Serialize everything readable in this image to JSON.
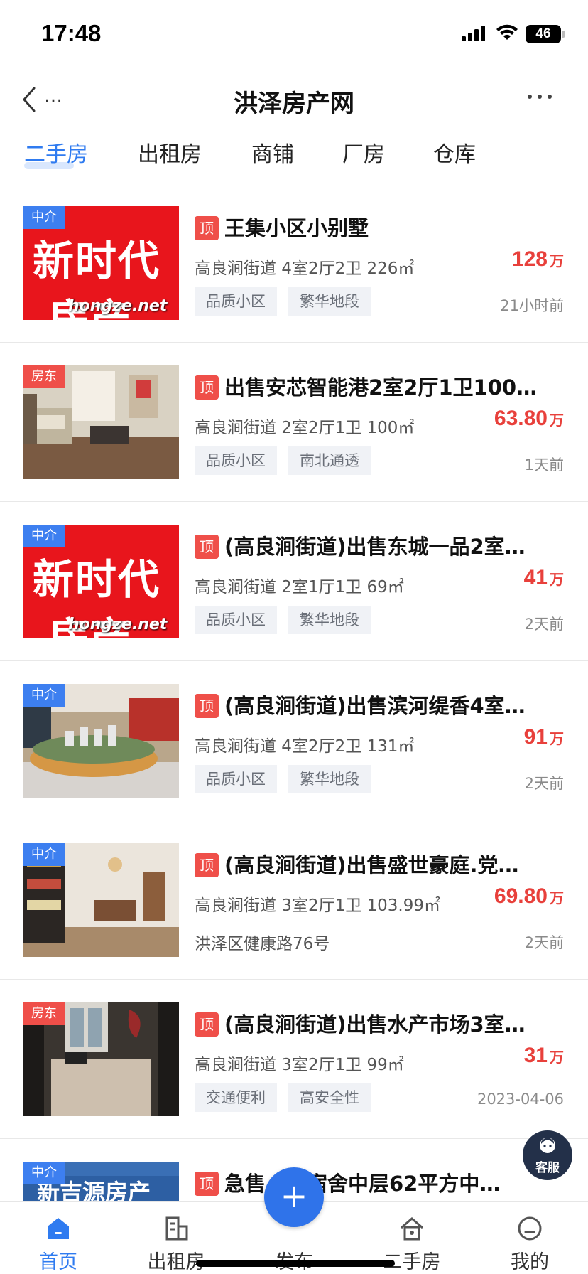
{
  "status_bar": {
    "time": "17:48",
    "battery": "46"
  },
  "navbar": {
    "back_dots": "…",
    "title": "洪泽房产网"
  },
  "tabs": [
    {
      "label": "二手房",
      "active": true
    },
    {
      "label": "出租房",
      "active": false
    },
    {
      "label": "商铺",
      "active": false
    },
    {
      "label": "厂房",
      "active": false
    },
    {
      "label": "仓库",
      "active": false
    }
  ],
  "top_badge": "顶",
  "price_unit": "万",
  "ad": {
    "line1": "新时代",
    "line2": "房产",
    "url": "hongze.net",
    "line1_alt": "新吉源房产"
  },
  "listings": [
    {
      "tag": "中介",
      "tag_color": "#3d7ff0",
      "thumb": "ad",
      "title": "王集小区小别墅",
      "info": "高良涧街道  4室2厅2卫  226㎡",
      "price": "128",
      "chips": [
        "品质小区",
        "繁华地段"
      ],
      "address": "",
      "time": "21小时前"
    },
    {
      "tag": "房东",
      "tag_color": "#ef4f49",
      "thumb": "living",
      "title": "出售安芯智能港2室2厅1卫100…",
      "info": "高良涧街道  2室2厅1卫  100㎡",
      "price": "63.80",
      "chips": [
        "品质小区",
        "南北通透"
      ],
      "address": "",
      "time": "1天前"
    },
    {
      "tag": "中介",
      "tag_color": "#3d7ff0",
      "thumb": "ad",
      "title": "(高良涧街道)出售东城一品2室…",
      "info": "高良涧街道  2室1厅1卫  69㎡",
      "price": "41",
      "chips": [
        "品质小区",
        "繁华地段"
      ],
      "address": "",
      "time": "2天前"
    },
    {
      "tag": "中介",
      "tag_color": "#3d7ff0",
      "thumb": "model",
      "title": "(高良涧街道)出售滨河缇香4室…",
      "info": "高良涧街道  4室2厅2卫  131㎡",
      "price": "91",
      "chips": [
        "品质小区",
        "繁华地段"
      ],
      "address": "",
      "time": "2天前"
    },
    {
      "tag": "中介",
      "tag_color": "#3d7ff0",
      "thumb": "dining",
      "title": "(高良涧街道)出售盛世豪庭.党…",
      "info": "高良涧街道  3室2厅1卫  103.99㎡",
      "price": "69.80",
      "chips": [],
      "address": "洪泽区健康路76号",
      "time": "2天前"
    },
    {
      "tag": "房东",
      "tag_color": "#ef4f49",
      "thumb": "kitchen",
      "title": "(高良涧街道)出售水产市场3室…",
      "info": "高良涧街道  3室2厅1卫  99㎡",
      "price": "31",
      "chips": [
        "交通便利",
        "高安全性"
      ],
      "address": "",
      "time": "2023-04-06"
    },
    {
      "tag": "中介",
      "tag_color": "#3d7ff0",
      "thumb": "sign",
      "title": "急售…院宿舍中层62平方中…",
      "info": "",
      "price": "",
      "chips": [],
      "address": "",
      "time": ""
    }
  ],
  "customer_service": "客服",
  "tabbar": [
    {
      "label": "首页",
      "icon": "home-icon",
      "active": true
    },
    {
      "label": "出租房",
      "icon": "building-icon",
      "active": false
    },
    {
      "label": "发布",
      "icon": "plus-icon",
      "active": false
    },
    {
      "label": "二手房",
      "icon": "house-icon",
      "active": false
    },
    {
      "label": "我的",
      "icon": "user-icon",
      "active": false
    }
  ],
  "publish_symbol": "+"
}
